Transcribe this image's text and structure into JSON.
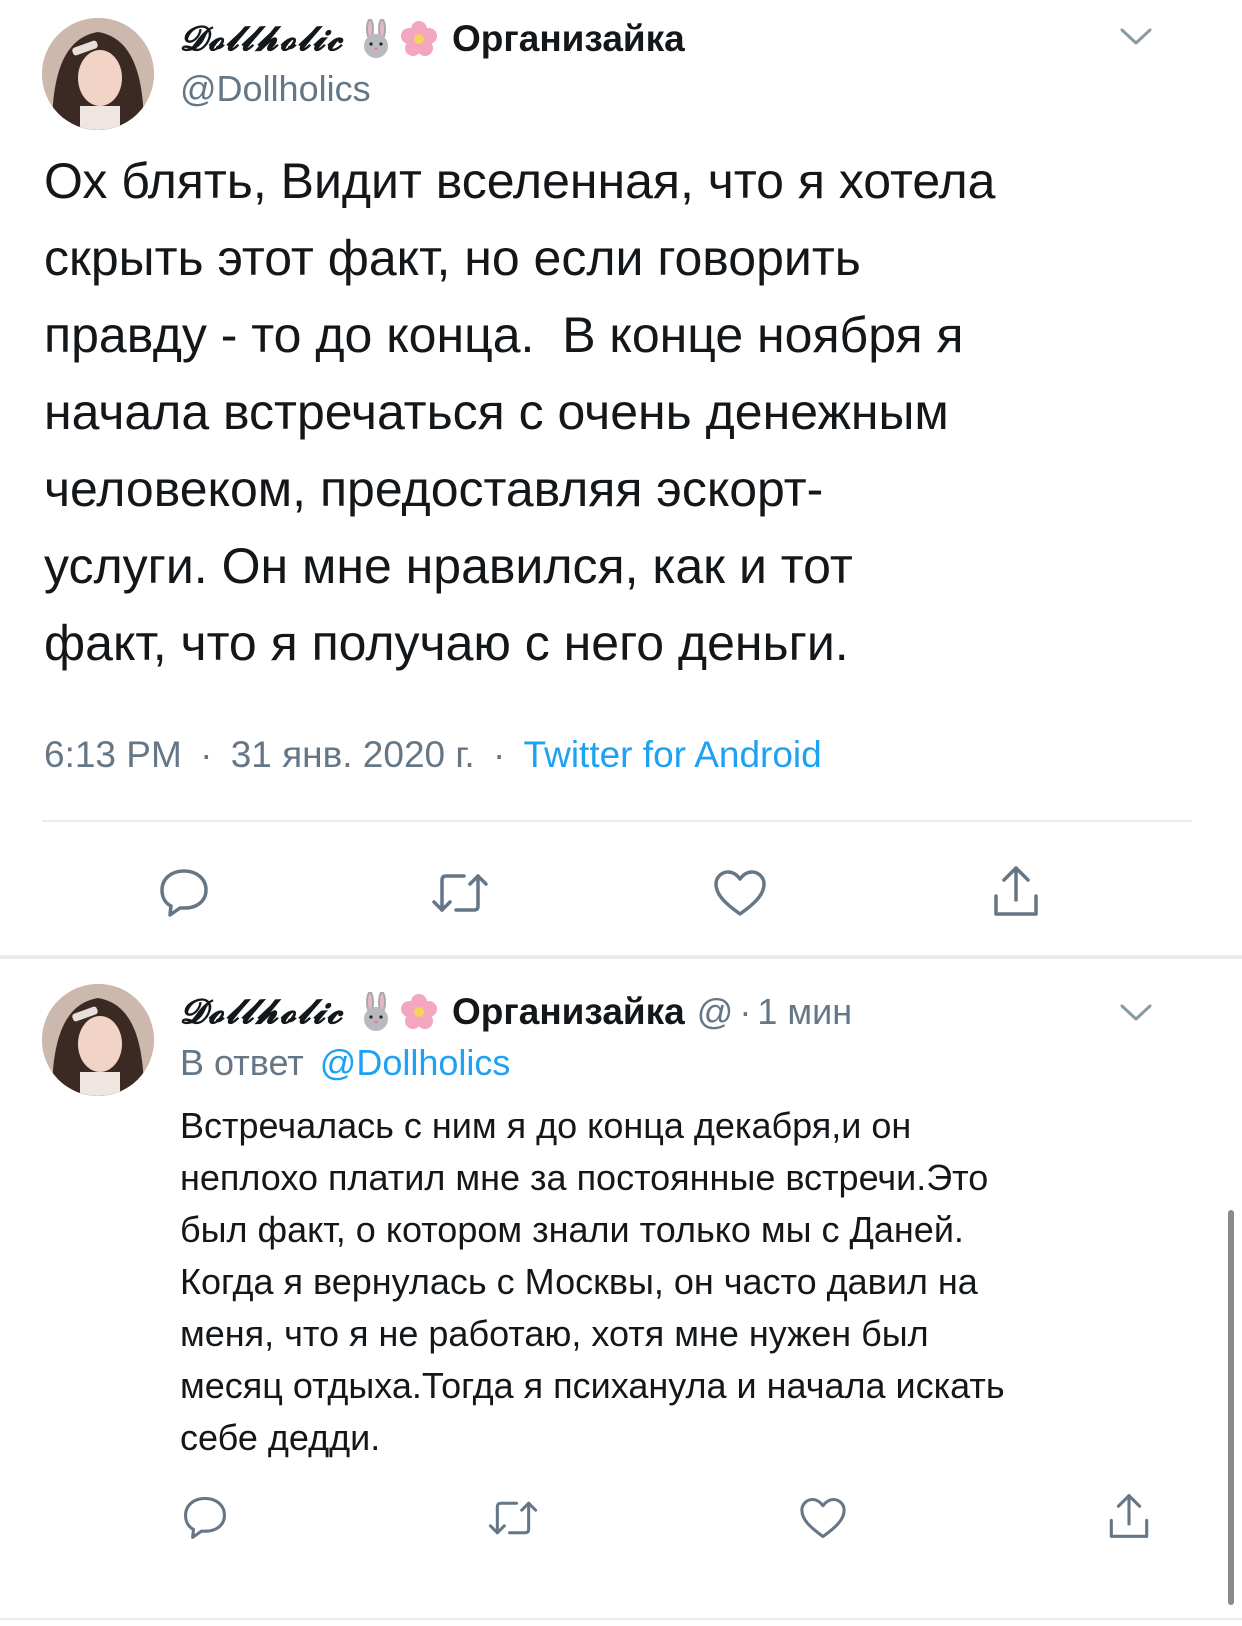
{
  "tweet": {
    "display_name": "𝓓𝓸𝓵𝓵𝓱𝓸𝓵𝓲𝓬",
    "community": "Организайка",
    "handle": "@Dollholics",
    "body": "Ох блять, Видит вселенная, что я хотела\nскрыть этот факт, но если говорить\nправду - то до конца.  В конце ноября я\nначала встречаться с очень денежным\nчеловеком, предоставляя эскорт-\nуслуги. Он мне нравился, как и тот\nфакт, что я получаю с него деньги.",
    "time": "6:13 PM",
    "date": "31 янв. 2020 г.",
    "separator": "·",
    "source": "Twitter for Android"
  },
  "reply": {
    "display_name": "𝓓𝓸𝓵𝓵𝓱𝓸𝓵𝓲𝓬",
    "community": "Организайка",
    "handle_partial": "@",
    "separator": "·",
    "age": "1 мин",
    "reply_to_prefix": "В ответ",
    "reply_to_handle": "@Dollholics",
    "body": "Встречалась с ним я до конца декабря,и он\nнеплохо платил мне за постоянные встречи.Это\nбыл факт, о котором знали только мы с Даней.\nКогда я вернулась с Москвы, он часто давил на\nменя, что я не работаю, хотя мне нужен был\nмесяц отдыха.Тогда я психанула и начала искать\nсебе дедди."
  },
  "icons": {
    "reply": "speech-bubble-icon",
    "retweet": "retweet-arrows-icon",
    "like": "heart-icon",
    "share": "share-upload-icon",
    "caret": "chevron-down-icon",
    "rabbit": "rabbit-emoji",
    "flower": "cherry-blossom-emoji"
  },
  "colors": {
    "text": "#14171a",
    "secondary": "#657786",
    "link": "#1da1f2",
    "divider": "#e6ecf0",
    "icon": "#657786"
  }
}
